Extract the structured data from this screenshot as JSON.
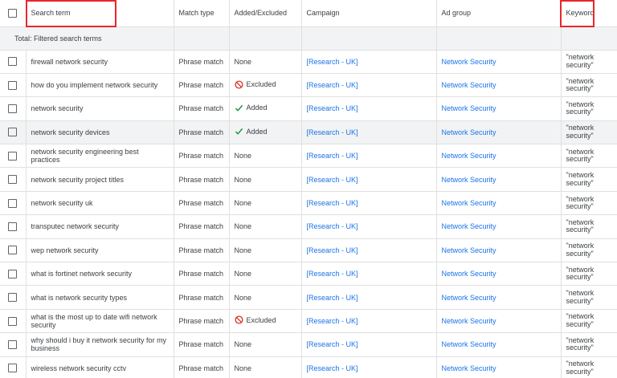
{
  "headers": {
    "search_term": "Search term",
    "match_type": "Match type",
    "added_excluded": "Added/Excluded",
    "campaign": "Campaign",
    "ad_group": "Ad group",
    "keyword": "Keyword"
  },
  "total_label": "Total: Filtered search terms",
  "colors": {
    "link": "#1a73e8",
    "added_check": "#1e8e3e",
    "excluded_icon": "#d93025",
    "highlight": "#e8262b"
  },
  "rows": [
    {
      "term": "firewall network security",
      "match": "Phrase match",
      "status": "None",
      "status_icon": "",
      "campaign": "[Research - UK]",
      "ad_group": "Network Security",
      "keyword": "\"network security\""
    },
    {
      "term": "how do you implement network security",
      "match": "Phrase match",
      "status": "Excluded",
      "status_icon": "block-icon",
      "campaign": "[Research - UK]",
      "ad_group": "Network Security",
      "keyword": "\"network security\""
    },
    {
      "term": "network security",
      "match": "Phrase match",
      "status": "Added",
      "status_icon": "check-icon",
      "campaign": "[Research - UK]",
      "ad_group": "Network Security",
      "keyword": "\"network security\""
    },
    {
      "term": "network security devices",
      "match": "Phrase match",
      "status": "Added",
      "status_icon": "check-icon",
      "campaign": "[Research - UK]",
      "ad_group": "Network Security",
      "keyword": "\"network security\""
    },
    {
      "term": "network security engineering best practices",
      "match": "Phrase match",
      "status": "None",
      "status_icon": "",
      "campaign": "[Research - UK]",
      "ad_group": "Network Security",
      "keyword": "\"network security\""
    },
    {
      "term": "network security project titles",
      "match": "Phrase match",
      "status": "None",
      "status_icon": "",
      "campaign": "[Research - UK]",
      "ad_group": "Network Security",
      "keyword": "\"network security\""
    },
    {
      "term": "network security uk",
      "match": "Phrase match",
      "status": "None",
      "status_icon": "",
      "campaign": "[Research - UK]",
      "ad_group": "Network Security",
      "keyword": "\"network security\""
    },
    {
      "term": "transputec network security",
      "match": "Phrase match",
      "status": "None",
      "status_icon": "",
      "campaign": "[Research - UK]",
      "ad_group": "Network Security",
      "keyword": "\"network security\""
    },
    {
      "term": "wep network security",
      "match": "Phrase match",
      "status": "None",
      "status_icon": "",
      "campaign": "[Research - UK]",
      "ad_group": "Network Security",
      "keyword": "\"network security\""
    },
    {
      "term": "what is fortinet network security",
      "match": "Phrase match",
      "status": "None",
      "status_icon": "",
      "campaign": "[Research - UK]",
      "ad_group": "Network Security",
      "keyword": "\"network security\""
    },
    {
      "term": "what is network security types",
      "match": "Phrase match",
      "status": "None",
      "status_icon": "",
      "campaign": "[Research - UK]",
      "ad_group": "Network Security",
      "keyword": "\"network security\""
    },
    {
      "term": "what is the most up to date wifi network security",
      "match": "Phrase match",
      "status": "Excluded",
      "status_icon": "block-icon",
      "campaign": "[Research - UK]",
      "ad_group": "Network Security",
      "keyword": "\"network security\""
    },
    {
      "term": "why should i buy it network security for my business",
      "match": "Phrase match",
      "status": "None",
      "status_icon": "",
      "campaign": "[Research - UK]",
      "ad_group": "Network Security",
      "keyword": "\"network security\""
    },
    {
      "term": "wireless network security cctv",
      "match": "Phrase match",
      "status": "None",
      "status_icon": "",
      "campaign": "[Research - UK]",
      "ad_group": "Network Security",
      "keyword": "\"network security\""
    }
  ]
}
